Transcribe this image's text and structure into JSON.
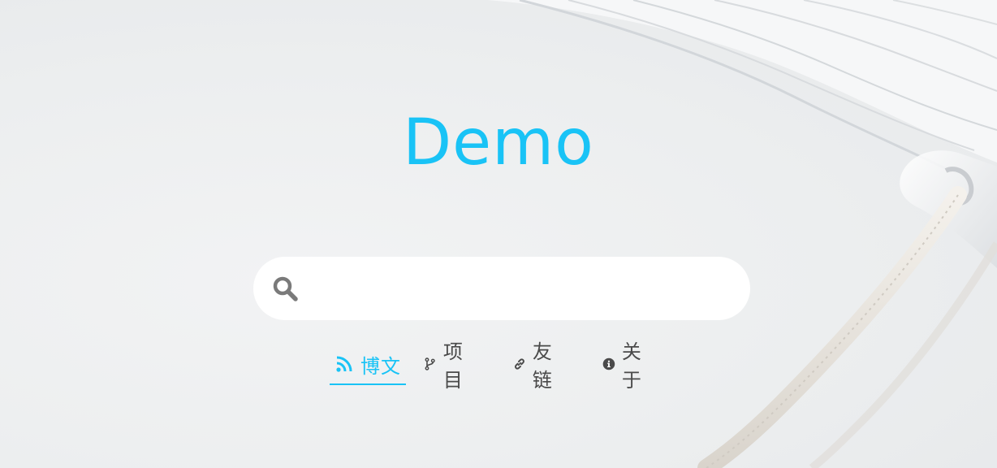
{
  "site": {
    "title": "Demo"
  },
  "search": {
    "placeholder": "",
    "value": "",
    "icon": "search-icon"
  },
  "nav": {
    "items": [
      {
        "label": "博文",
        "icon": "rss-icon",
        "active": true
      },
      {
        "label": "项目",
        "icon": "code-branch-icon",
        "active": false
      },
      {
        "label": "友链",
        "icon": "link-icon",
        "active": false
      },
      {
        "label": "关于",
        "icon": "info-circle-icon",
        "active": false
      }
    ]
  },
  "colors": {
    "accent": "#19c3f6",
    "text": "#4a4a4a",
    "search_bg": "#ffffff",
    "page_bg": "#eceeef"
  }
}
